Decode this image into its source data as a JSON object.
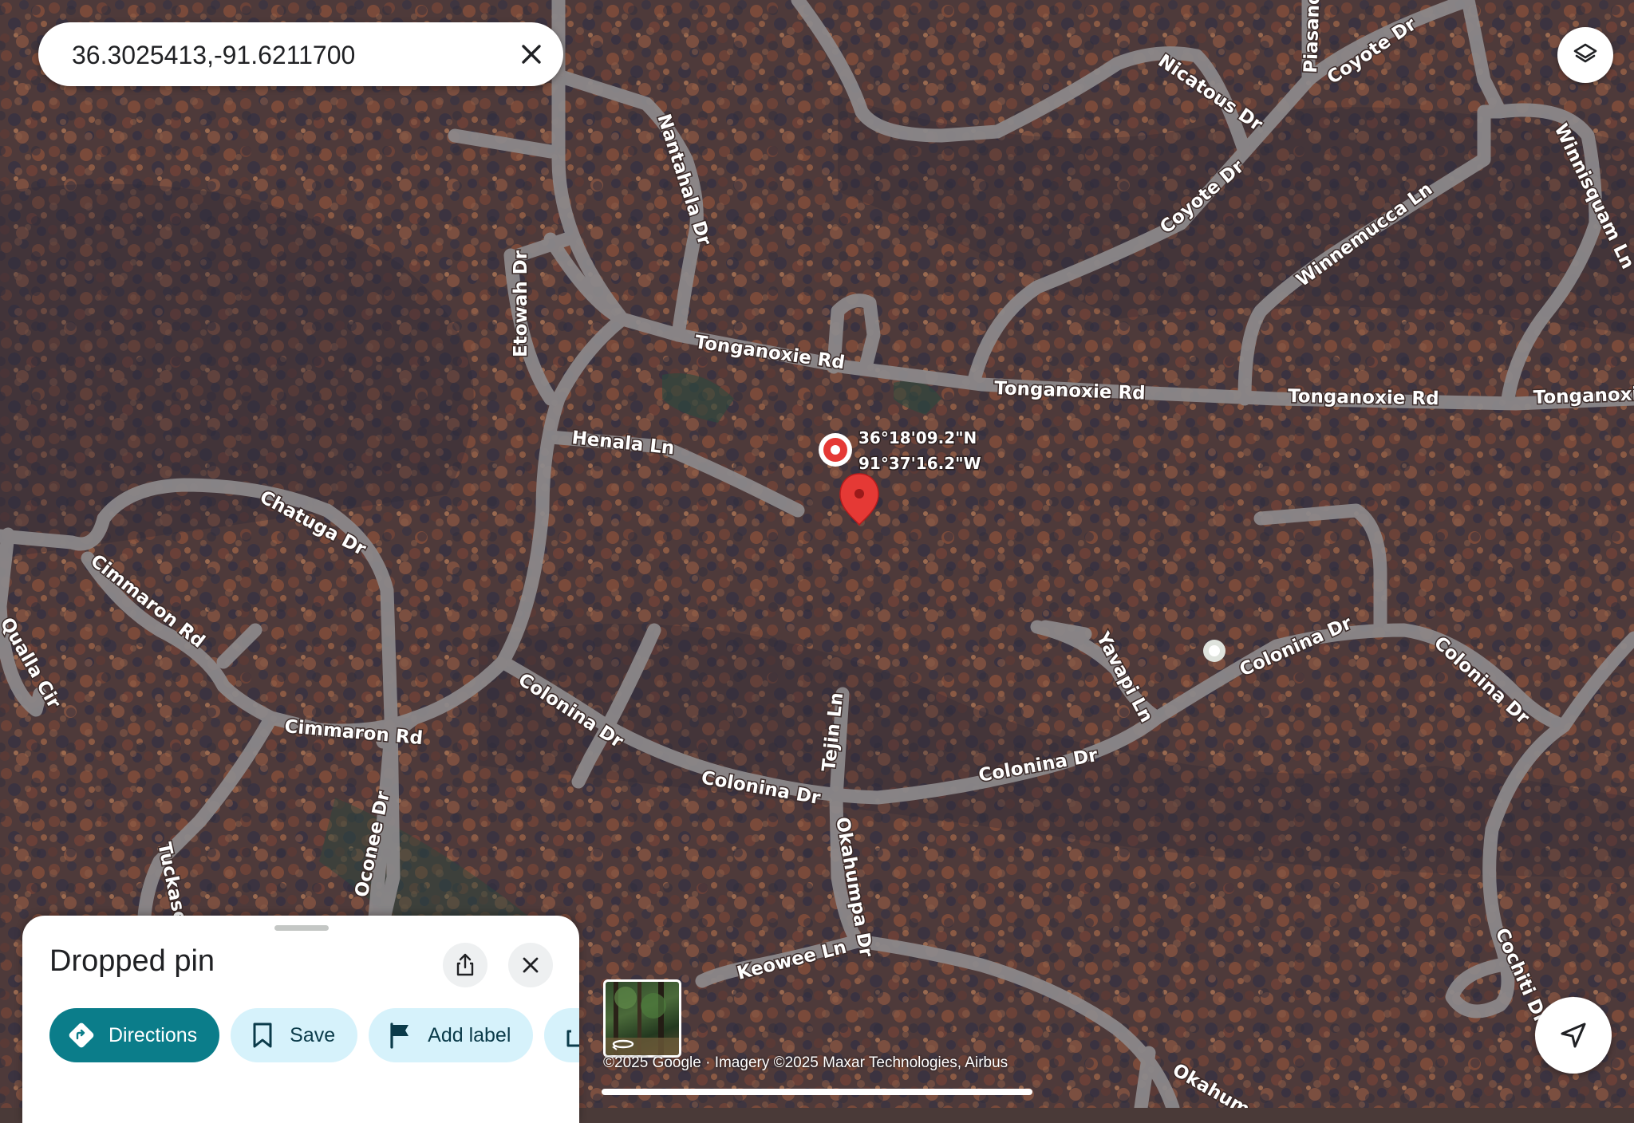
{
  "search": {
    "value": "36.3025413,-91.6211700",
    "clear_icon": "close-icon"
  },
  "layers_button": {
    "icon": "layers-icon"
  },
  "map": {
    "marker_coords": {
      "lat": "36°18'09.2\"N",
      "lng": "91°37'16.2\"W"
    },
    "road_labels": {
      "tonganoxie_1": "Tonganoxie Rd",
      "tonganoxie_2": "Tonganoxie Rd",
      "tonganoxie_3": "Tonganoxie Rd",
      "tonganoxie_4": "Tonganoxie",
      "nantahala": "Nantahala Dr",
      "etowah": "Etowah Dr",
      "henala": "Henala Ln",
      "chatuga": "Chatuga Dr",
      "cimmaron_1": "Cimmaron Rd",
      "cimmaron_2": "Cimmaron Rd",
      "qualla": "Qualla Cir",
      "colonina_1": "Colonina Dr",
      "colonina_2": "Colonina Dr",
      "colonina_3": "Colonina Dr",
      "colonina_4": "Colonina Dr",
      "colonina_5": "Colonina Dr",
      "tejin": "Tejin Ln",
      "okahumpa_1": "Okahumpa Dr",
      "okahumpa_2": "Okahum",
      "keowee": "Keowee Ln",
      "yavapi": "Yavapi Ln",
      "oconee": "Oconee Dr",
      "tuckase": "Tuckase",
      "nicatous": "Nicatous Dr",
      "piasano": "Piasano",
      "coyote_1": "Coyote Dr",
      "coyote_2": "Coyote Dr",
      "winnemucca": "Winnemucca Ln",
      "winnisquam": "Winnisquam Ln",
      "cochiti": "Cochiti Dr"
    }
  },
  "sheet": {
    "title": "Dropped pin",
    "share_icon": "share-icon",
    "close_icon": "close-icon",
    "actions": [
      {
        "label": "Directions",
        "icon": "directions-icon"
      },
      {
        "label": "Save",
        "icon": "bookmark-icon"
      },
      {
        "label": "Add label",
        "icon": "flag-icon"
      }
    ]
  },
  "attribution": "©2025 Google · Imagery ©2025 Maxar Technologies, Airbus",
  "navigate_button": {
    "icon": "navigation-arrow-icon"
  },
  "colors": {
    "primary_chip": "#0b7d8a",
    "secondary_chip": "#d6f2fb",
    "pin": "#e53935"
  }
}
